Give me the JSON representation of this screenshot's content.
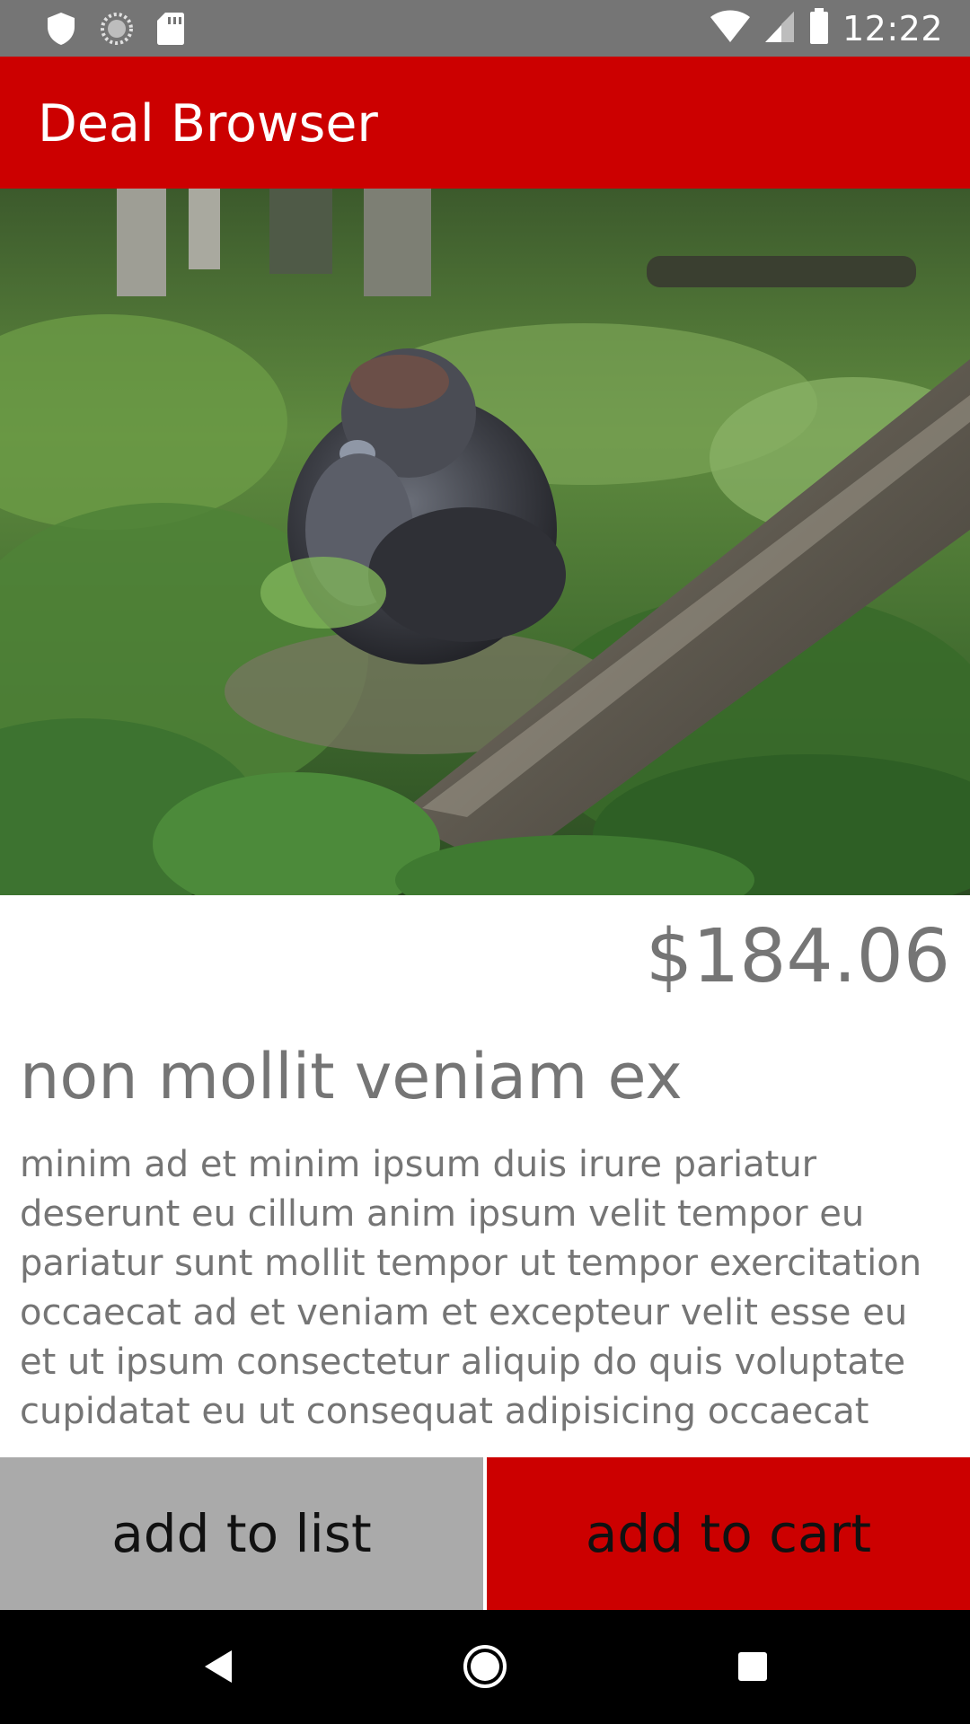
{
  "status_bar": {
    "time": "12:22",
    "icons": [
      "shield-icon",
      "sync-icon",
      "sd-card-icon",
      "wifi-icon",
      "signal-icon",
      "battery-icon"
    ]
  },
  "app_bar": {
    "title": "Deal Browser",
    "color": "#cc0000"
  },
  "product": {
    "price": "$184.06",
    "title": "non mollit veniam ex",
    "description": "minim ad et minim ipsum duis irure pariatur deserunt eu cillum anim ipsum velit tempor eu pariatur sunt mollit tempor ut tempor exercitation occaecat ad et veniam et excepteur velit esse eu et ut ipsum consectetur aliquip do quis voluptate cupidatat eu ut consequat adipisicing occaecat"
  },
  "actions": {
    "add_to_list": "add to list",
    "add_to_cart": "add to cart"
  },
  "nav_bar": {
    "icons": [
      "back-icon",
      "home-icon",
      "recents-icon"
    ]
  }
}
